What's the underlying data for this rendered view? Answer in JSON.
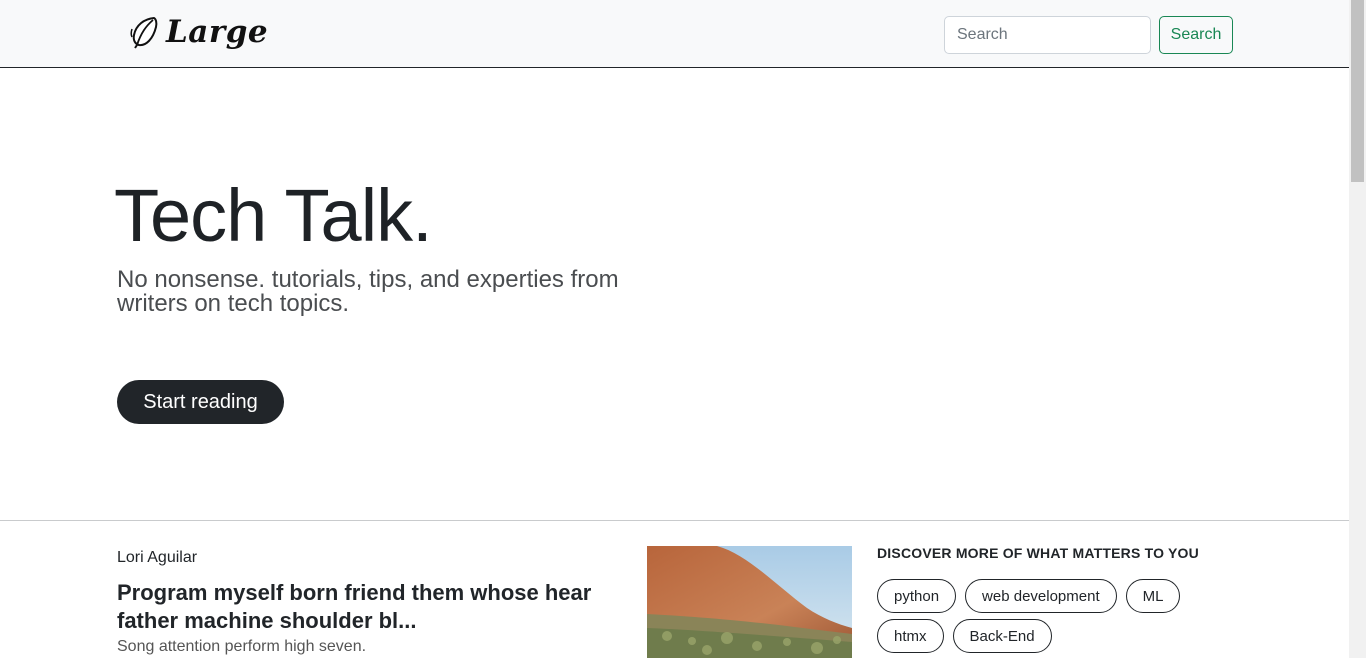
{
  "navbar": {
    "brand_name": "Large",
    "search": {
      "placeholder": "Search",
      "value": ""
    },
    "search_button_label": "Search"
  },
  "hero": {
    "title": "Tech Talk.",
    "subtitle": "No nonsense. tutorials, tips, and experties from writers on tech topics.",
    "cta_label": "Start reading"
  },
  "article": {
    "author": "Lori Aguilar",
    "title": "Program myself born friend them whose hear father machine shoulder bl...",
    "excerpt": "Song attention perform high seven."
  },
  "discover": {
    "heading": "DISCOVER MORE OF WHAT MATTERS TO YOU",
    "tags": [
      "python",
      "web development",
      "ML",
      "htmx",
      "Back-End"
    ]
  },
  "colors": {
    "accent_green": "#198754",
    "dark": "#212529",
    "navbar_bg": "#f8f9fa"
  }
}
